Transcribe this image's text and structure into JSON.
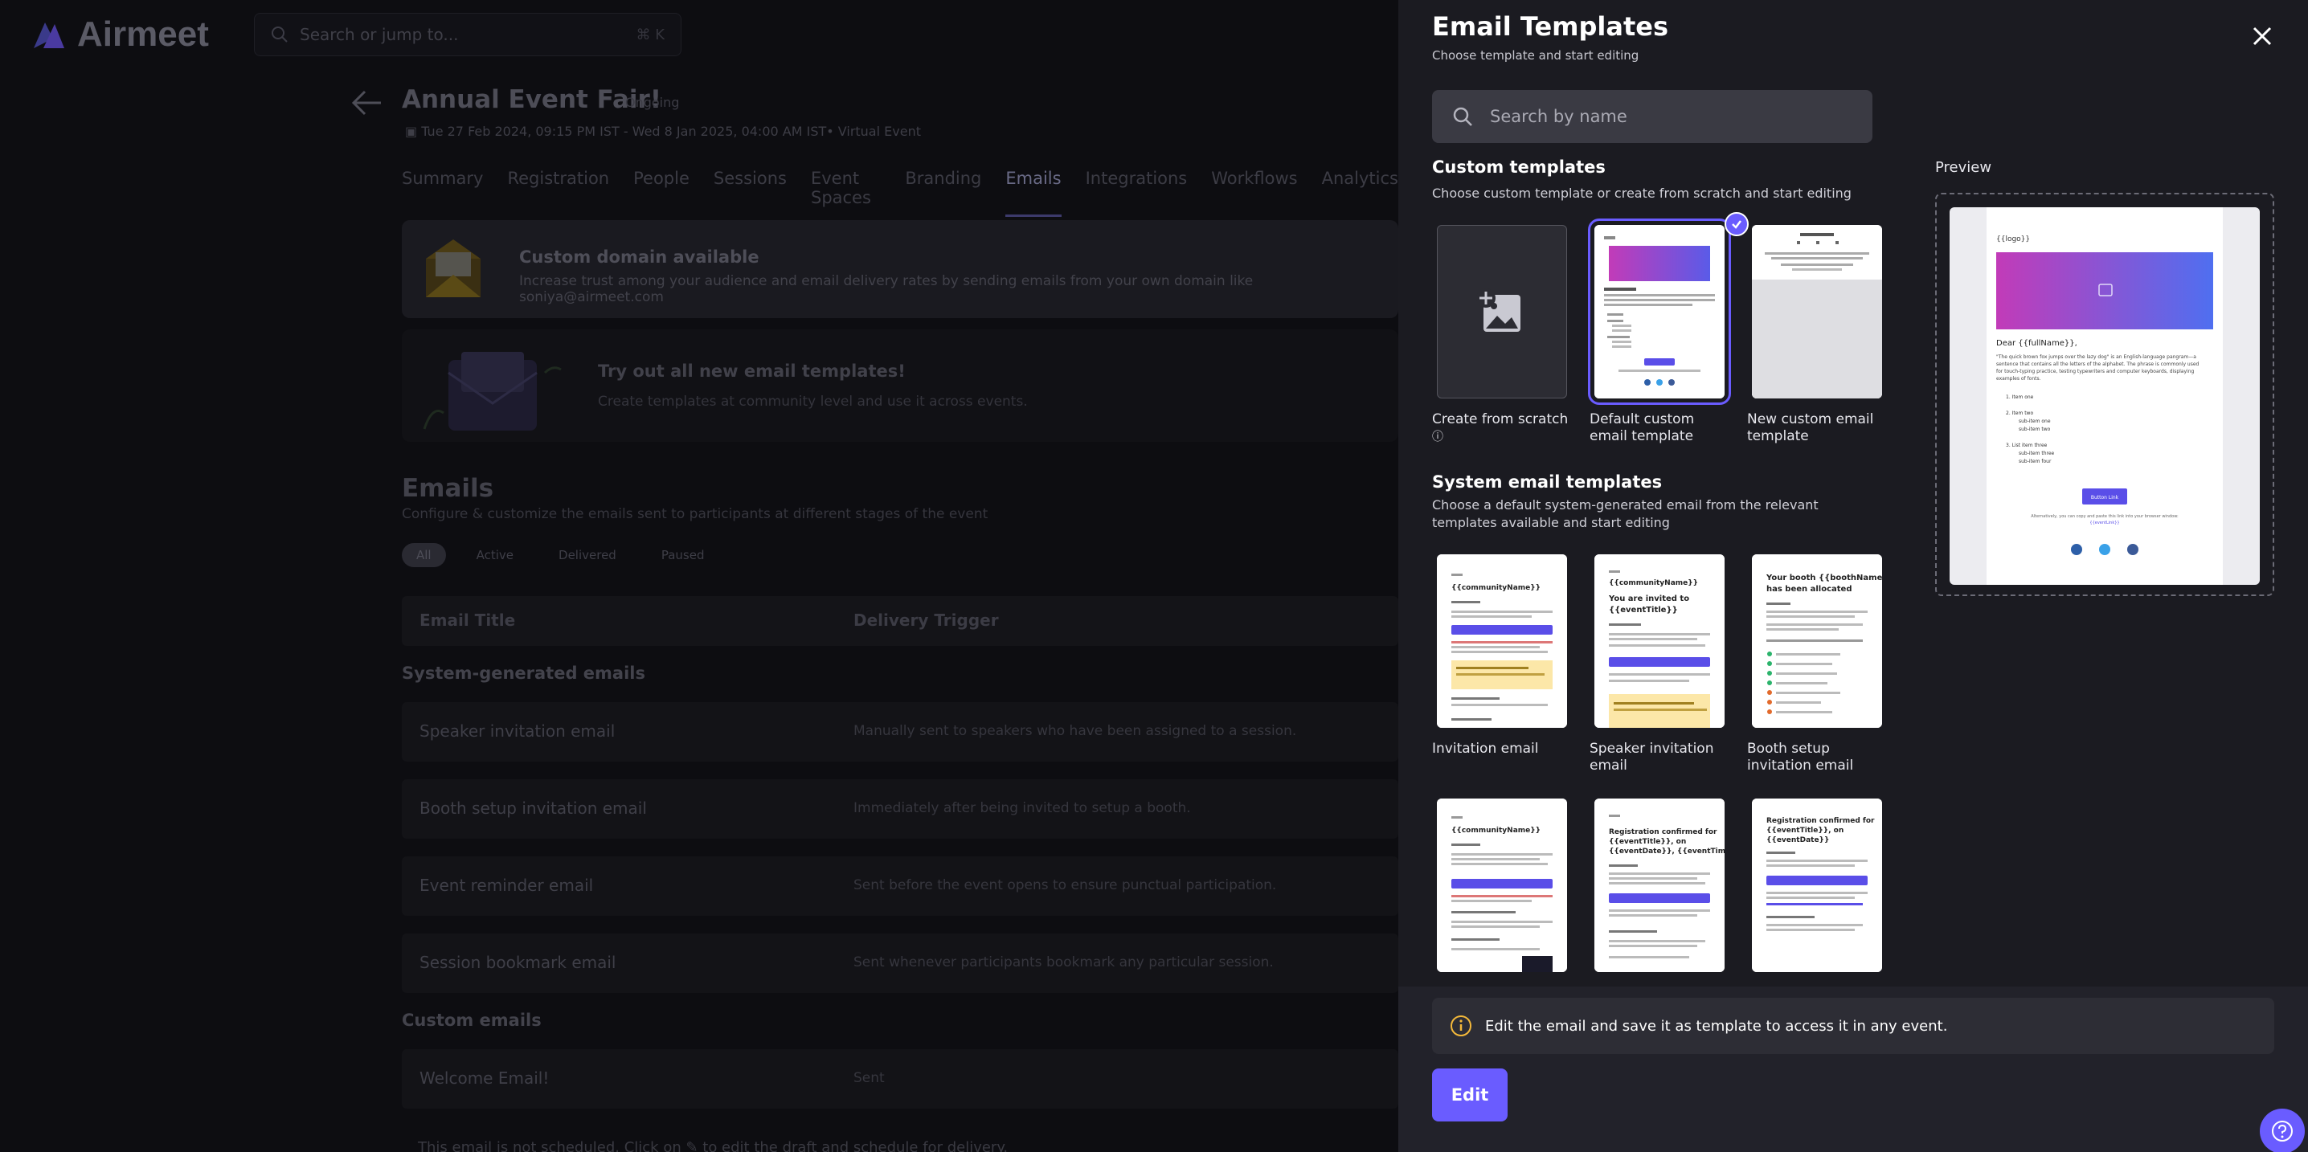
{
  "app": {
    "brand": "Airmeet",
    "search_placeholder": "Search or jump to...",
    "search_shortcut": "⌘ K"
  },
  "event": {
    "title": "Annual Event Fair!",
    "status": "Ongoing",
    "dates": "Tue 27 Feb 2024, 09:15 PM IST - Wed 8 Jan 2025, 04:00 AM IST• Virtual Event"
  },
  "tabs": [
    "Summary",
    "Registration",
    "People",
    "Sessions",
    "Event Spaces",
    "Branding",
    "Emails",
    "Integrations",
    "Workflows",
    "Analytics"
  ],
  "active_tab": "Emails",
  "banner_domain": {
    "title": "Custom domain available",
    "text": "Increase trust among your audience and email delivery rates by sending emails from your own domain like soniya@airmeet.com"
  },
  "banner_templates": {
    "title": "Try out all new email templates!",
    "text": "Create templates at community level and use it across events."
  },
  "emails": {
    "heading": "Emails",
    "subheading": "Configure & customize the emails sent to participants at different stages of the event",
    "filters": [
      "All",
      "Active",
      "Delivered",
      "Paused"
    ],
    "columns": [
      "Email Title",
      "Delivery Trigger"
    ],
    "system_section": "System-generated emails",
    "system_rows": [
      {
        "title": "Speaker invitation email",
        "trigger": "Manually sent to speakers who have been assigned to a session."
      },
      {
        "title": "Booth setup invitation email",
        "trigger": "Immediately after being invited to setup a booth."
      },
      {
        "title": "Event reminder email",
        "trigger": "Sent before the event opens to ensure punctual participation."
      },
      {
        "title": "Session bookmark email",
        "trigger": "Sent whenever participants bookmark any particular session."
      }
    ],
    "custom_section": "Custom emails",
    "custom_rows": [
      {
        "title": "Welcome Email!",
        "trigger": "Sent"
      }
    ],
    "footnote": "This email is not scheduled. Click on ✎ to edit the draft and schedule for delivery."
  },
  "panel": {
    "title": "Email Templates",
    "subtitle": "Choose template and start editing",
    "search_placeholder": "Search by name",
    "custom": {
      "heading": "Custom templates",
      "subheading": "Choose custom template or create from scratch and start editing",
      "items": [
        "Create from scratch",
        "Default custom email template",
        "New custom email template"
      ],
      "selected": "Default custom email template"
    },
    "system": {
      "heading": "System email templates",
      "subheading": "Choose a default system-generated email from the relevant templates available and start editing",
      "items": [
        "Invitation email",
        "Speaker invitation email",
        "Booth setup invitation email"
      ]
    },
    "thumb_text": {
      "community": "{{communityName}}",
      "invited": "You are invited to {{eventTitle}}",
      "booth": "Your booth {{boothName}} has been allocated",
      "reg_date": "Registration confirmed for {{eventTitle}}, on {{eventDate}}, {{eventTime}}",
      "reg": "Registration confirmed for {{eventTitle}}, on {{eventDate}}"
    },
    "preview": {
      "label": "Preview",
      "logo": "{{logo}}",
      "greeting": "Dear {{fullName}},",
      "body": "\"The quick brown fox jumps over the lazy dog\" is an English-language pangram—a sentence that contains all the letters of the alphabet. The phrase is commonly used for touch-typing practice, testing typewriters and computer keyboards, displaying examples of fonts.",
      "list": [
        "Item one",
        "Item two",
        "sub-item one",
        "sub-item two",
        "List item three",
        "sub-item three",
        "sub-item four"
      ],
      "button": "Button Link",
      "footer": "Alternatively, you can copy and paste this link into your browser window: {{eventLink}}"
    },
    "info": "Edit the email and save it as template to access it in any event.",
    "edit_label": "Edit"
  },
  "colors": {
    "accent": "#6a5cff",
    "panel_bg": "#1b1b21",
    "overlay_bg": "#0d0d11"
  }
}
